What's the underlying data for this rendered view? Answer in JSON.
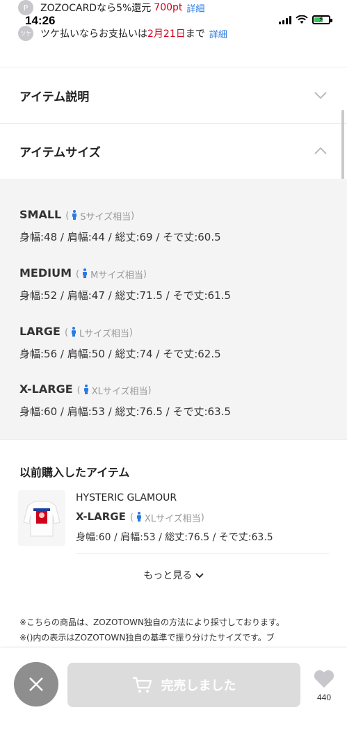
{
  "status": {
    "time": "14:26",
    "battery_level": 0.55
  },
  "promos": [
    {
      "icon": "P",
      "text": "ZOZOCARDなら5%還元",
      "highlight": "700pt",
      "link": "詳細"
    },
    {
      "icon": "ツケ",
      "text_before": "ツケ払いならお支払いは",
      "highlight": "2月21日",
      "text_after": "まで",
      "link": "詳細"
    }
  ],
  "accordions": {
    "description": {
      "title": "アイテム説明",
      "state": "collapsed"
    },
    "sizes": {
      "title": "アイテムサイズ",
      "state": "expanded"
    }
  },
  "sizes": [
    {
      "name": "SMALL",
      "equiv": "Sサイズ相当",
      "measure": "身幅:48 / 肩幅:44 / 総丈:69 / そで丈:60.5"
    },
    {
      "name": "MEDIUM",
      "equiv": "Mサイズ相当",
      "measure": "身幅:52 / 肩幅:47 / 総丈:71.5 / そで丈:61.5"
    },
    {
      "name": "LARGE",
      "equiv": "Lサイズ相当",
      "measure": "身幅:56 / 肩幅:50 / 総丈:74 / そで丈:62.5"
    },
    {
      "name": "X-LARGE",
      "equiv": "XLサイズ相当",
      "measure": "身幅:60 / 肩幅:53 / 総丈:76.5 / そで丈:63.5"
    }
  ],
  "previous": {
    "title": "以前購入したアイテム",
    "brand": "HYSTERIC GLAMOUR",
    "size": "X-LARGE",
    "equiv": "XLサイズ相当",
    "measure": "身幅:60 / 肩幅:53 / 総丈:76.5 / そで丈:63.5",
    "more": "もっと見る"
  },
  "notes": [
    "※こちらの商品は、ZOZOTOWN独自の方法により採寸しております。",
    "※()内の表示はZOZOTOWN独自の基準で振り分けたサイズです。ブ"
  ],
  "bottom": {
    "soldout_label": "完売しました",
    "fav_count": "440"
  },
  "colors": {
    "accent_red": "#d0021b",
    "link_blue": "#2a7ae2",
    "person_icon": "#2a7ae2"
  },
  "icons": {
    "close": "close-icon",
    "cart": "cart-icon",
    "heart": "heart-icon",
    "chevron_down": "chevron-down-icon",
    "chevron_up": "chevron-up-icon",
    "person": "person-icon"
  }
}
